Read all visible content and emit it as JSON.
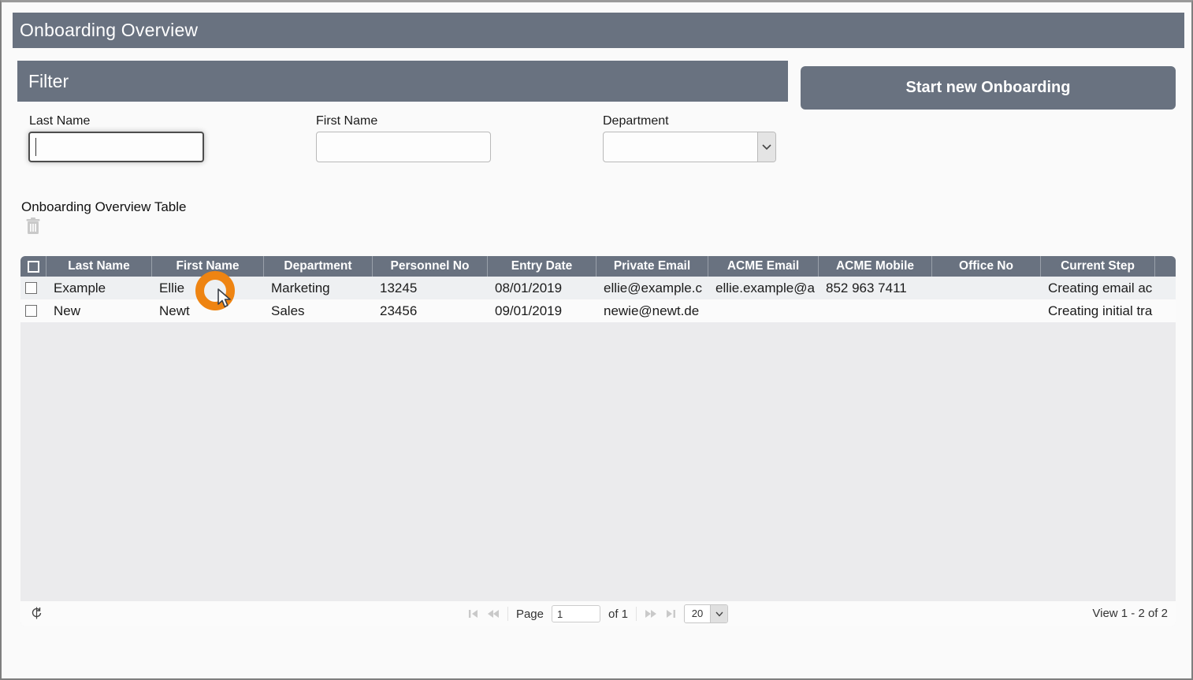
{
  "window": {
    "title": "Onboarding Overview"
  },
  "filter": {
    "title": "Filter",
    "last_name": {
      "label": "Last Name",
      "value": "",
      "placeholder": ""
    },
    "first_name": {
      "label": "First Name",
      "value": "",
      "placeholder": ""
    },
    "department": {
      "label": "Department",
      "selected_value": ""
    },
    "start_button_label": "Start new Onboarding"
  },
  "table_section": {
    "caption": "Onboarding Overview Table",
    "delete_icon": "trash-icon"
  },
  "table": {
    "columns": [
      "Last Name",
      "First Name",
      "Department",
      "Personnel No",
      "Entry Date",
      "Private Email",
      "ACME Email",
      "ACME Mobile",
      "Office No",
      "Current Step"
    ],
    "rows": [
      {
        "checked": false,
        "cells": [
          "Example",
          "Ellie",
          "Marketing",
          "13245",
          "08/01/2019",
          "ellie@example.c",
          "ellie.example@a",
          "852 963 7411",
          "",
          "Creating email ac"
        ]
      },
      {
        "checked": false,
        "cells": [
          "New",
          "Newt",
          "Sales",
          "23456",
          "09/01/2019",
          "newie@newt.de",
          "",
          "",
          "",
          "Creating initial tra"
        ]
      }
    ]
  },
  "pager": {
    "first_icon": "page-first-icon",
    "prev_icon": "page-prev-icon",
    "next_icon": "page-next-icon",
    "last_icon": "page-last-icon",
    "refresh_icon": "refresh-icon",
    "page_label": "Page",
    "page_value": "1",
    "of_label": "of 1",
    "page_size": "20",
    "view_label": "View 1 - 2 of 2"
  },
  "colors": {
    "accent_gray": "#697280",
    "click_indicator_orange": "#ee8412"
  }
}
